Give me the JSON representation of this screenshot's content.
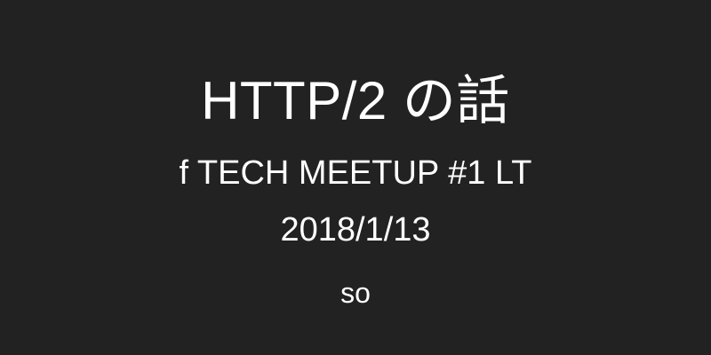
{
  "slide": {
    "title": "HTTP/2 の話",
    "subtitle": "f TECH MEETUP #1 LT",
    "date": "2018/1/13",
    "author": "so"
  },
  "colors": {
    "background": "#222222",
    "text": "#ffffff"
  }
}
